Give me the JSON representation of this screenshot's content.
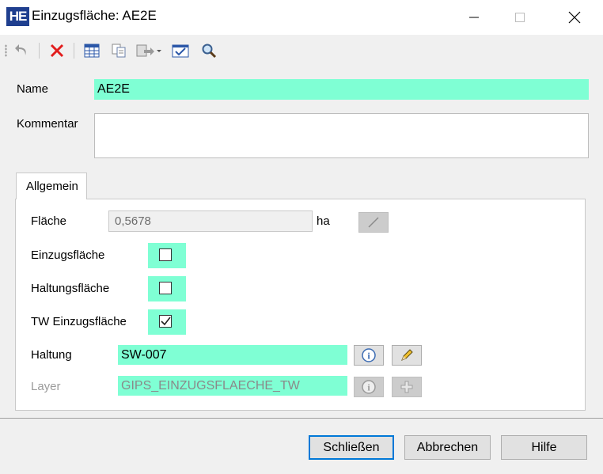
{
  "window": {
    "app_icon_text": "HE",
    "title": "Einzugsfläche: AE2E"
  },
  "toolbar": {
    "icons": [
      "undo-icon",
      "delete-icon",
      "table-icon",
      "copy-icon",
      "export-dropdown-icon",
      "checklist-icon",
      "search-icon"
    ]
  },
  "form": {
    "name_label": "Name",
    "name_value": "AE2E",
    "comment_label": "Kommentar",
    "comment_value": ""
  },
  "tabs": [
    {
      "label": "Allgemein",
      "active": true
    }
  ],
  "general": {
    "flaeche_label": "Fläche",
    "flaeche_value": "0,5678",
    "flaeche_unit": "ha",
    "einzugsflaeche_label": "Einzugsfläche",
    "einzugsflaeche_checked": false,
    "haltungsflaeche_label": "Haltungsfläche",
    "haltungsflaeche_checked": false,
    "tw_einzugsflaeche_label": "TW Einzugsfläche",
    "tw_einzugsflaeche_checked": true,
    "haltung_label": "Haltung",
    "haltung_value": "SW-007",
    "layer_label": "Layer",
    "layer_value": "GIPS_EINZUGSFLAECHE_TW"
  },
  "buttons": {
    "close": "Schließen",
    "cancel": "Abbrechen",
    "help": "Hilfe"
  },
  "colors": {
    "highlight_field": "#7fffd4",
    "default_button_border": "#0078d7",
    "app_icon_bg": "#1f3f8f"
  }
}
